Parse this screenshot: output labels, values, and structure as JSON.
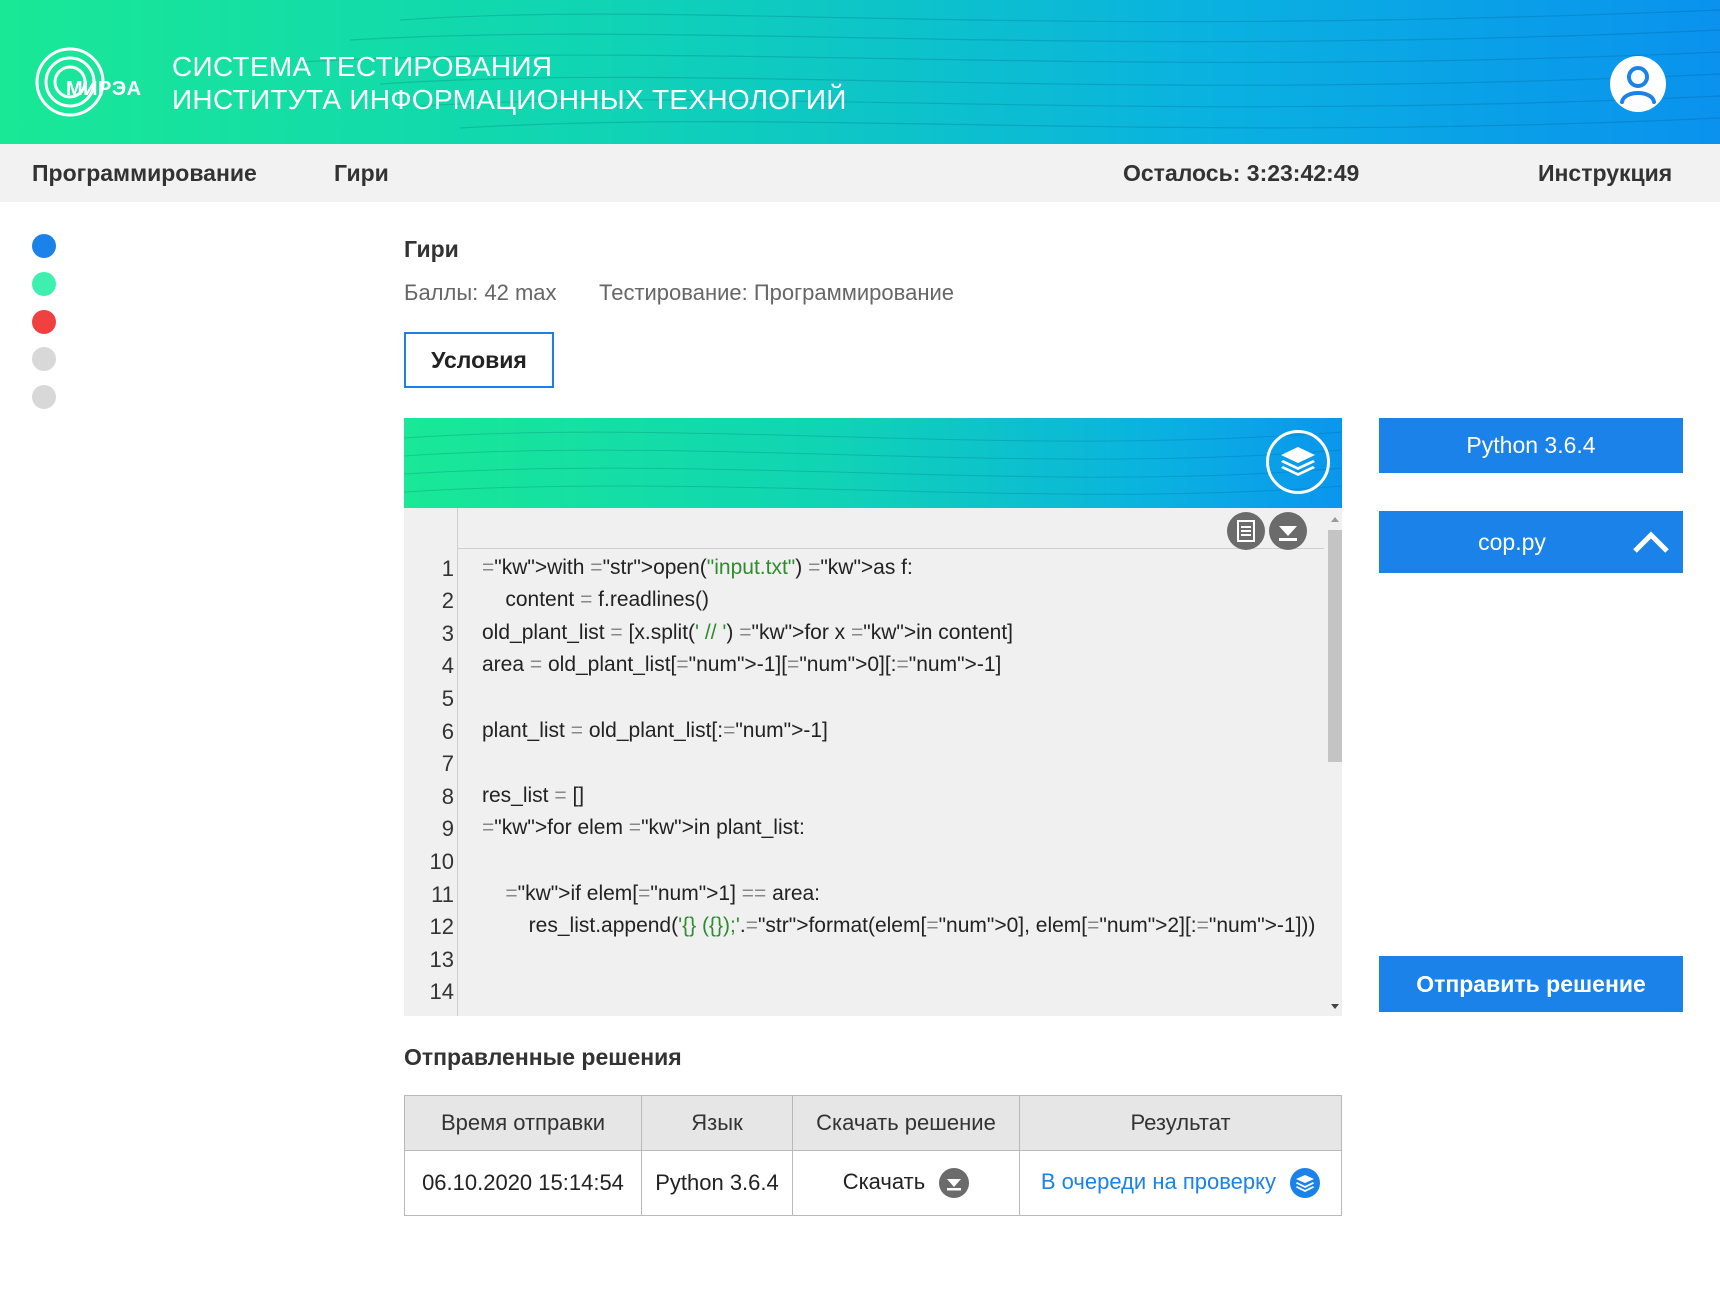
{
  "header": {
    "logo_text": "МИРЭА",
    "title_line1": "СИСТЕМА ТЕСТИРОВАНИЯ",
    "title_line2": "ИНСТИТУТА ИНФОРМАЦИОННЫХ ТЕХНОЛОГИЙ",
    "avatar_icon": "user-icon"
  },
  "nav": {
    "subject": "Программирование",
    "task": "Гири",
    "timer": "Осталось: 3:23:42:49",
    "instructions": "Инструкция"
  },
  "dots": [
    {
      "color": "#1a82e8"
    },
    {
      "color": "#3ef0b0"
    },
    {
      "color": "#f04040"
    },
    {
      "color": "#d8d8d8"
    },
    {
      "color": "#d8d8d8"
    }
  ],
  "task": {
    "title": "Гири",
    "points": "Баллы: 42 max",
    "testing": "Тестирование: Программирование",
    "conditions_label": "Условия"
  },
  "editor": {
    "line_numbers": [
      "1",
      "2",
      "3",
      "4",
      "5",
      "6",
      "7",
      "8",
      "9",
      "10",
      "11",
      "12",
      "13",
      "14"
    ],
    "lines": [
      "with open(\"input.txt\") as f:",
      "    content = f.readlines()",
      "old_plant_list = [x.split(' // ') for x in content]",
      "area = old_plant_list[-1][0][:-1]",
      "",
      "plant_list = old_plant_list[:-1]",
      "",
      "res_list = []",
      "for elem in plant_list:",
      "",
      "    if elem[1] == area:",
      "        res_list.append('{} ({});'.format(elem[0], elem[2][:-1]))",
      "",
      ""
    ]
  },
  "right": {
    "language": "Python 3.6.4",
    "file": "cop.py",
    "submit": "Отправить решение"
  },
  "submissions": {
    "title": "Отправленные решения",
    "headers": [
      "Время отправки",
      "Язык",
      "Скачать решение",
      "Результат"
    ],
    "rows": [
      {
        "time": "06.10.2020 15:14:54",
        "lang": "Python 3.6.4",
        "download": "Скачать",
        "result": "В очереди на проверку"
      }
    ]
  },
  "colors": {
    "accent": "#1a82e8",
    "gradient_start": "#19e896",
    "gradient_end": "#0a92ee"
  }
}
